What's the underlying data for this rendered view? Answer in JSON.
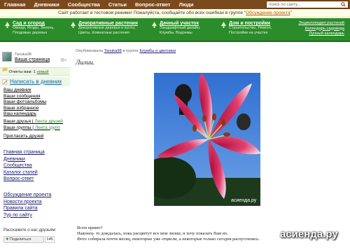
{
  "topnav": {
    "items": [
      "Главная",
      "Дневники",
      "Сообщества",
      "Статьи",
      "Вопрос-ответ",
      "Люди"
    ],
    "search_placeholder": "поиск по сайту..."
  },
  "notice": {
    "text": "Сайт работает в тестовом режиме! Пожалуйста, сообщайте обо всех ошибках в группе \"",
    "link": "Обсуждение проекта",
    "tail": "\""
  },
  "categories": [
    {
      "title": "Сад и огород",
      "sub1": "Овощи, Ягоды, Зелень,",
      "sub2": "Плодовые деревья"
    },
    {
      "title": "Декоративные растения",
      "sub1": "Декоративные деревья и кусты,",
      "sub2": "Цветы, Комнатные растения"
    },
    {
      "title": "Дачный участок",
      "sub1": "Ландшафтный дизайн,",
      "sub2": "Клумбы, Водоемы"
    },
    {
      "title": "Дом и постройки",
      "sub1": "Строительство, Ремонт,",
      "sub2": "Постройки на участке"
    }
  ],
  "categories_right": [
    "Энциклопедия растений",
    "Календарь садовода",
    "Лунный календарь"
  ],
  "user": {
    "name": "Tanuka98",
    "page_link": "Ваша страница"
  },
  "answers": {
    "label": "Ответы вам:",
    "count": "1",
    "new_label": "новый"
  },
  "write_label": "Написать в дневник",
  "diary_links": [
    "Ваш дневник",
    "Ваши сообщения",
    "Ваши фотоальбомы",
    "Ваше избранное",
    "Ваш календарь"
  ],
  "friends": {
    "label": "Ваши друзья",
    "sep": "|",
    "feed": "Лента друзей"
  },
  "groups": {
    "label": "Ваши группы",
    "sep": "|",
    "feed": "Лента групп"
  },
  "invite_label": "Пригласить друзей",
  "main_links": [
    "Главная страница",
    "Дневники",
    "Сообщества",
    "Каталог статей",
    "Вопрос-ответ"
  ],
  "project_links": [
    "Обсуждение проекта",
    "Новости проекта",
    "Правила сайта",
    "Тур по сайту"
  ],
  "share": {
    "label": "Расскажите о нас друзьям:",
    "button": "Поделиться",
    "count": "145"
  },
  "post": {
    "meta_prefix": "Опубликовала",
    "author": "Tanuka98",
    "meta_mid": "в группе",
    "group": "Клумбы и цветники",
    "title": "Лилии.",
    "photo_watermark": "асиенда.ру",
    "line1": "Всем привет!",
    "line2": "Наконец- то дождалась, пока расцветут все мои лилии, и хочу показать Вам их.",
    "line3": "Фото собирала почти месяц, некоторые уже отцвели, а некоторые только сегодня распустились."
  },
  "site_watermark": "асиенда.ру",
  "colors": {
    "nav_bg": "#7a4a1e",
    "band_bg": "#2a8c2a",
    "link": "#1a1a70"
  }
}
